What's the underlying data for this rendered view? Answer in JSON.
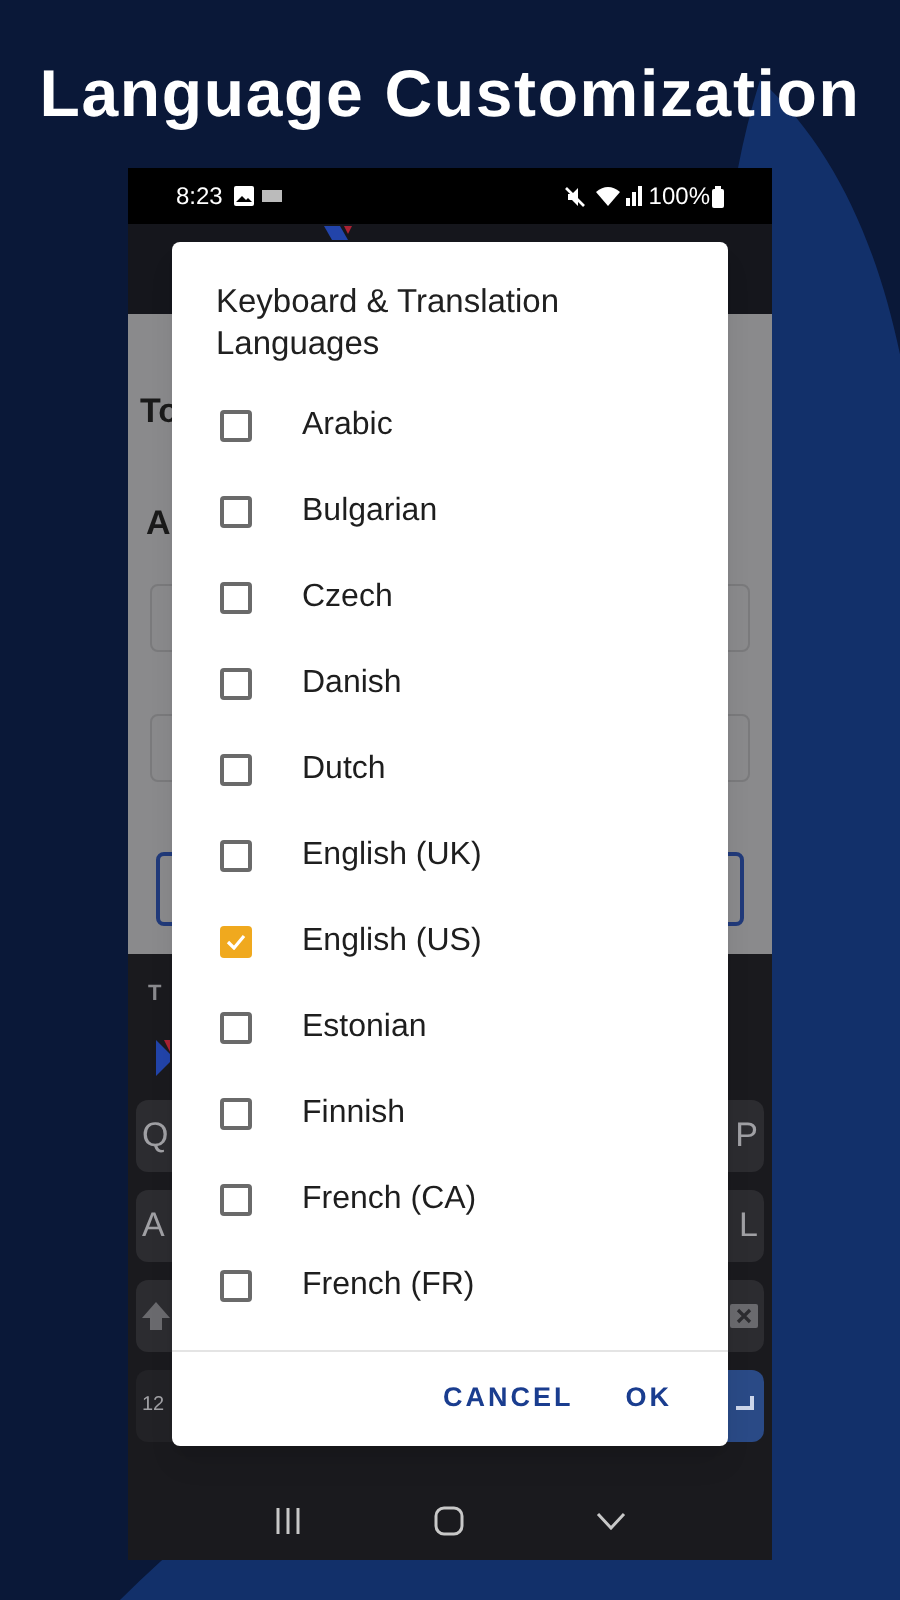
{
  "header": {
    "title": "Language Customization"
  },
  "status_bar": {
    "time": "8:23",
    "battery": "100%"
  },
  "backdrop": {
    "texts": [
      "To",
      "A"
    ],
    "toolbar_label": "T",
    "keys": [
      [
        "Q",
        "P"
      ],
      [
        "A",
        "L"
      ]
    ],
    "bottom_key": "12"
  },
  "dialog": {
    "title": "Keyboard & Translation Languages",
    "languages": [
      {
        "label": "Arabic",
        "checked": false
      },
      {
        "label": "Bulgarian",
        "checked": false
      },
      {
        "label": "Czech",
        "checked": false
      },
      {
        "label": "Danish",
        "checked": false
      },
      {
        "label": "Dutch",
        "checked": false
      },
      {
        "label": "English (UK)",
        "checked": false
      },
      {
        "label": "English (US)",
        "checked": true
      },
      {
        "label": "Estonian",
        "checked": false
      },
      {
        "label": "Finnish",
        "checked": false
      },
      {
        "label": "French (CA)",
        "checked": false
      },
      {
        "label": "French (FR)",
        "checked": false
      }
    ],
    "buttons": [
      "CANCEL",
      "OK"
    ]
  }
}
